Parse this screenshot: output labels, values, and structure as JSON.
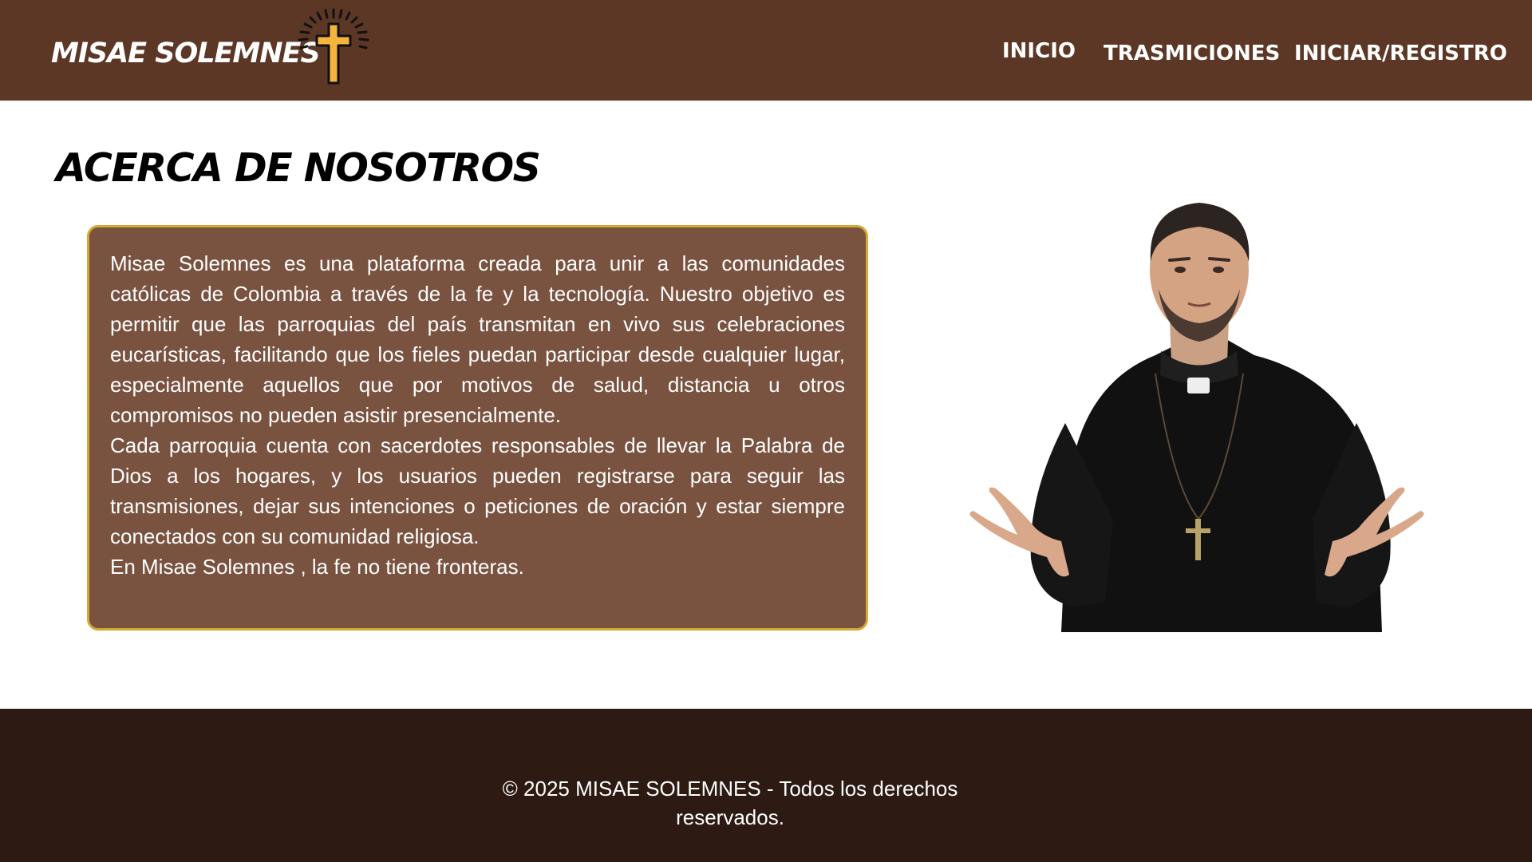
{
  "header": {
    "brand": "MISAE SOLEMNES",
    "logo_icon": "cross-with-rays-icon",
    "nav": {
      "inicio": "INICIO",
      "trasmiciones": "TRASMICIONES",
      "login": "INICIAR/REGISTRO"
    }
  },
  "main": {
    "title": "ACERCA DE NOSOTROS",
    "paragraphs": [
      "Misae Solemnes es una plataforma creada para unir a las comunidades católicas de Colombia a través de la fe y la tecnología. Nuestro objetivo es permitir que las parroquias del país transmitan en vivo sus celebraciones eucarísticas, facilitando que los fieles puedan participar desde cualquier lugar, especialmente aquellos que por motivos de salud, distancia u otros compromisos no pueden asistir presencialmente.",
      "Cada parroquia cuenta con sacerdotes responsables de llevar la Palabra de Dios a los hogares, y los usuarios pueden registrarse para seguir las transmisiones, dejar sus intenciones o peticiones de oración y estar siempre conectados con su comunidad religiosa.",
      "En Misae Solemnes , la fe no tiene fronteras."
    ]
  },
  "footer": {
    "copyright": "© 2025 MISAE SOLEMNES - Todos los derechos reservados."
  },
  "colors": {
    "header_bg": "#5c3726",
    "box_bg": "#795240",
    "box_border": "#d4a935",
    "footer_bg": "#2c1a13",
    "cross": "#f5b43c"
  }
}
